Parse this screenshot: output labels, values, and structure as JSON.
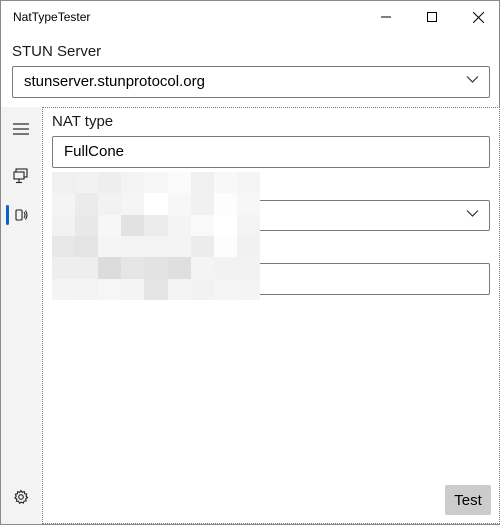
{
  "window": {
    "title": "NatTypeTester"
  },
  "stun": {
    "label": "STUN Server",
    "selected": "stunserver.stunprotocol.org"
  },
  "content": {
    "nat_type_label": "NAT type",
    "nat_type_value": "FullCone"
  },
  "actions": {
    "test_label": "Test"
  },
  "colors": {
    "accent": "#0a64c8",
    "nav_background": "#f3f3f3",
    "button_background": "#cccccc"
  }
}
